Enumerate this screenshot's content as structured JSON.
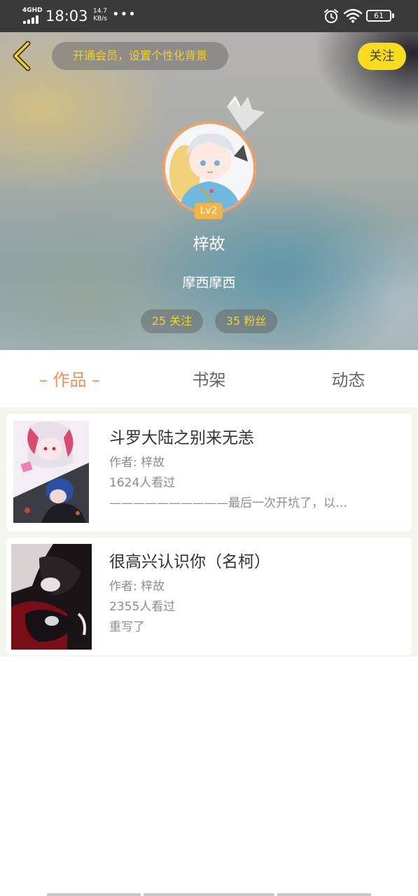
{
  "status_bar": {
    "network": "4GHD",
    "time": "18:03",
    "speed_value": "14.7",
    "speed_unit": "KB/s",
    "more": "•••",
    "battery": "61"
  },
  "header": {
    "vip_banner": "开通会员，设置个性化背景",
    "follow_label": "关注",
    "level": "Lv2",
    "username": "梓故",
    "bio": "摩西摩西",
    "following": "25 关注",
    "fans": "35 粉丝"
  },
  "tabs": [
    {
      "label": "– 作品 –",
      "active": true
    },
    {
      "label": "书架",
      "active": false
    },
    {
      "label": "动态",
      "active": false
    }
  ],
  "works": [
    {
      "title": "斗罗大陆之别来无恙",
      "author": "作者: 梓故",
      "views": "1624人看过",
      "desc": "——————————最后一次开坑了，以…"
    },
    {
      "title": "很高兴认识你（名柯）",
      "author": "作者: 梓故",
      "views": "2355人看过",
      "desc": "重写了"
    }
  ],
  "icons": {
    "back": "chevron-left-icon",
    "alarm": "alarm-icon",
    "wifi": "wifi-icon",
    "battery": "battery-icon",
    "signal": "signal-icon"
  },
  "colors": {
    "accent_orange": "#ef8f55",
    "accent_yellow": "#f8dc1e",
    "stat_text": "#f3d232",
    "level_badge": "#f5b444",
    "status_bar": "#3a3a3a"
  }
}
